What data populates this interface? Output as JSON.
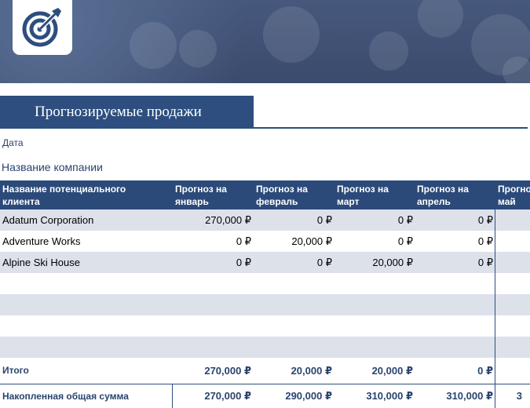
{
  "colors": {
    "accent": "#2d4e7e",
    "header_bg": "#2b4a7a",
    "row_shade": "#dde1ea",
    "banner": "#3f5275"
  },
  "logo_icon": "target-with-arrow-icon",
  "title": "Прогнозируемые продажи",
  "date_label": "Дата",
  "company_label": "Название компании",
  "table": {
    "headers": [
      "Название потенциального клиента",
      "Прогноз на январь",
      "Прогноз на февраль",
      "Прогноз на март",
      "Прогноз на апрель",
      "Прогноз на май"
    ],
    "rows": [
      {
        "client": "Adatum Corporation",
        "values": [
          "270,000 ₽",
          "0 ₽",
          "0 ₽",
          "0 ₽"
        ]
      },
      {
        "client": "Adventure Works",
        "values": [
          "0 ₽",
          "20,000 ₽",
          "0 ₽",
          "0 ₽"
        ]
      },
      {
        "client": "Alpine Ski House",
        "values": [
          "0 ₽",
          "0 ₽",
          "20,000 ₽",
          "0 ₽"
        ]
      }
    ],
    "total": {
      "label": "Итого",
      "values": [
        "270,000 ₽",
        "20,000 ₽",
        "20,000 ₽",
        "0 ₽"
      ]
    },
    "cumulative": {
      "label": "Накопленная общая сумма",
      "values": [
        "270,000 ₽",
        "290,000 ₽",
        "310,000 ₽",
        "310,000 ₽",
        "3"
      ]
    }
  }
}
